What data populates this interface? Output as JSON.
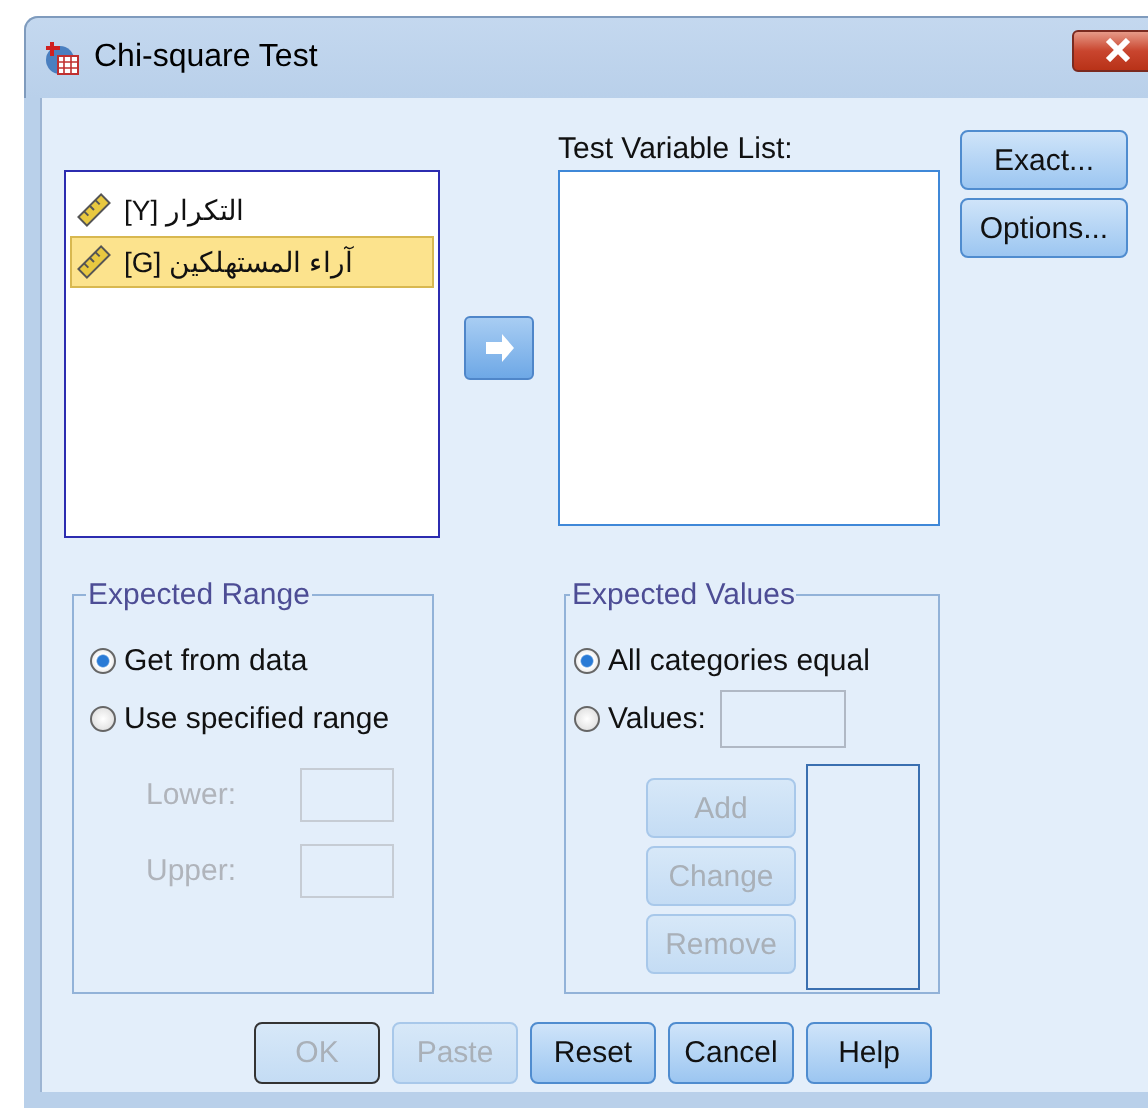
{
  "window": {
    "title": "Chi-square Test"
  },
  "source_list": {
    "items": [
      {
        "label": "[Y] التكرار",
        "selected": false
      },
      {
        "label": "[G]  آراء المستهلكين",
        "selected": true
      }
    ]
  },
  "test_variable_list": {
    "label": "Test Variable List:"
  },
  "side_buttons": [
    {
      "label": "Exact..."
    },
    {
      "label": "Options..."
    }
  ],
  "expected_range": {
    "title": "Expected Range",
    "options": [
      {
        "label": "Get from data",
        "selected": true
      },
      {
        "label": "Use specified range",
        "selected": false
      }
    ],
    "fields": [
      {
        "label": "Lower:",
        "disabled": true
      },
      {
        "label": "Upper:",
        "disabled": true
      }
    ]
  },
  "expected_values": {
    "title": "Expected Values",
    "options": [
      {
        "label": "All categories equal",
        "selected": true
      },
      {
        "label": "Values:",
        "selected": false
      }
    ],
    "buttons": [
      {
        "label": "Add",
        "disabled": true
      },
      {
        "label": "Change",
        "disabled": true
      },
      {
        "label": "Remove",
        "disabled": true
      }
    ]
  },
  "footer_buttons": [
    {
      "label": "OK",
      "disabled": true,
      "default": true
    },
    {
      "label": "Paste",
      "disabled": true,
      "default": false
    },
    {
      "label": "Reset",
      "disabled": false,
      "default": false
    },
    {
      "label": "Cancel",
      "disabled": false,
      "default": false
    },
    {
      "label": "Help",
      "disabled": false,
      "default": false
    }
  ]
}
